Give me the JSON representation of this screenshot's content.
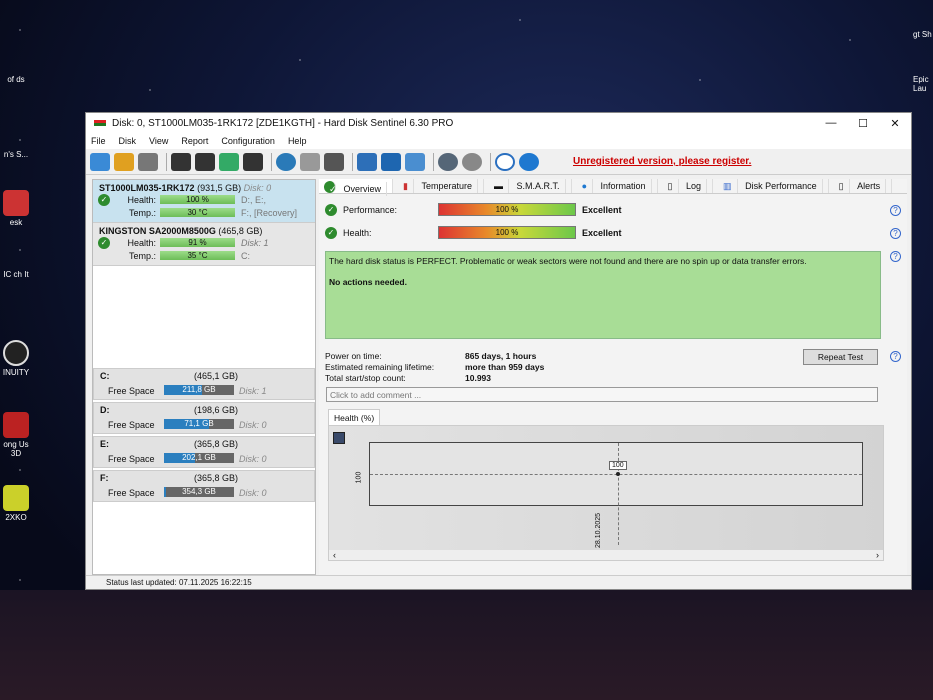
{
  "desktop": {
    "left_icons": [
      "of ds",
      "n's S...",
      "esk",
      "IC ch It",
      "INUITY",
      "ong Us 3D",
      "2XKO"
    ],
    "right_icons": [
      "gt Sh",
      "Epic Lau"
    ]
  },
  "window": {
    "title": "Disk: 0, ST1000LM035-1RK172 [ZDE1KGTH]  -  Hard Disk Sentinel 6.30 PRO",
    "minimize": "—",
    "maximize": "☐",
    "close": "✕"
  },
  "menu": [
    "File",
    "Disk",
    "View",
    "Report",
    "Configuration",
    "Help"
  ],
  "toolbar": {
    "unregistered": "Unregistered version, please register."
  },
  "disks": [
    {
      "name": "ST1000LM035-1RK172",
      "size": "(931,5 GB)",
      "disk": "Disk: 0",
      "health": "100 %",
      "temp": "30 °C",
      "extra1": "D:, E:,",
      "extra2": "F:, [Recovery]"
    },
    {
      "name": "KINGSTON SA2000M8500G",
      "size": "(465,8 GB)",
      "disk": "",
      "health": "91 %",
      "temp": "35 °C",
      "extra1": "Disk: 1",
      "extra2": "C:"
    }
  ],
  "labels": {
    "health": "Health:",
    "temp": "Temp.:",
    "free_space": "Free Space"
  },
  "partitions": [
    {
      "letter": "C:",
      "size": "(465,1 GB)",
      "free": "211,8 GB",
      "free_pct": 45.5,
      "disk": "Disk: 1"
    },
    {
      "letter": "D:",
      "size": "(198,6 GB)",
      "free": "71,1 GB",
      "free_pct": 35.8,
      "disk": "Disk: 0"
    },
    {
      "letter": "E:",
      "size": "(365,8 GB)",
      "free": "202,1 GB",
      "free_pct": 55.2,
      "disk": "Disk: 0"
    },
    {
      "letter": "F:",
      "size": "(365,8 GB)",
      "free": "354,3 GB",
      "free_pct": 96.9,
      "disk": "Disk: 0"
    }
  ],
  "tabs": [
    "Overview",
    "Temperature",
    "S.M.A.R.T.",
    "Information",
    "Log",
    "Disk Performance",
    "Alerts"
  ],
  "overview": {
    "performance": {
      "label": "Performance:",
      "value": "100 %",
      "rating": "Excellent"
    },
    "health": {
      "label": "Health:",
      "value": "100 %",
      "rating": "Excellent"
    },
    "status_text": "The hard disk status is PERFECT. Problematic or weak sectors were not found and there are no spin up or data transfer errors.",
    "action_text": "No actions needed.",
    "power_on_label": "Power on time:",
    "power_on": "865 days, 1 hours",
    "lifetime_label": "Estimated remaining lifetime:",
    "lifetime": "more than 959 days",
    "startstop_label": "Total start/stop count:",
    "startstop": "10.993",
    "repeat_test": "Repeat Test",
    "comment_placeholder": "Click to add comment ..."
  },
  "chart_data": {
    "type": "line",
    "title": "Health (%)",
    "x": [
      "28.10.2025"
    ],
    "values": [
      100
    ],
    "point_label": "100",
    "ytick": "100"
  },
  "statusbar": "Status last updated: 07.11.2025 16:22:15"
}
